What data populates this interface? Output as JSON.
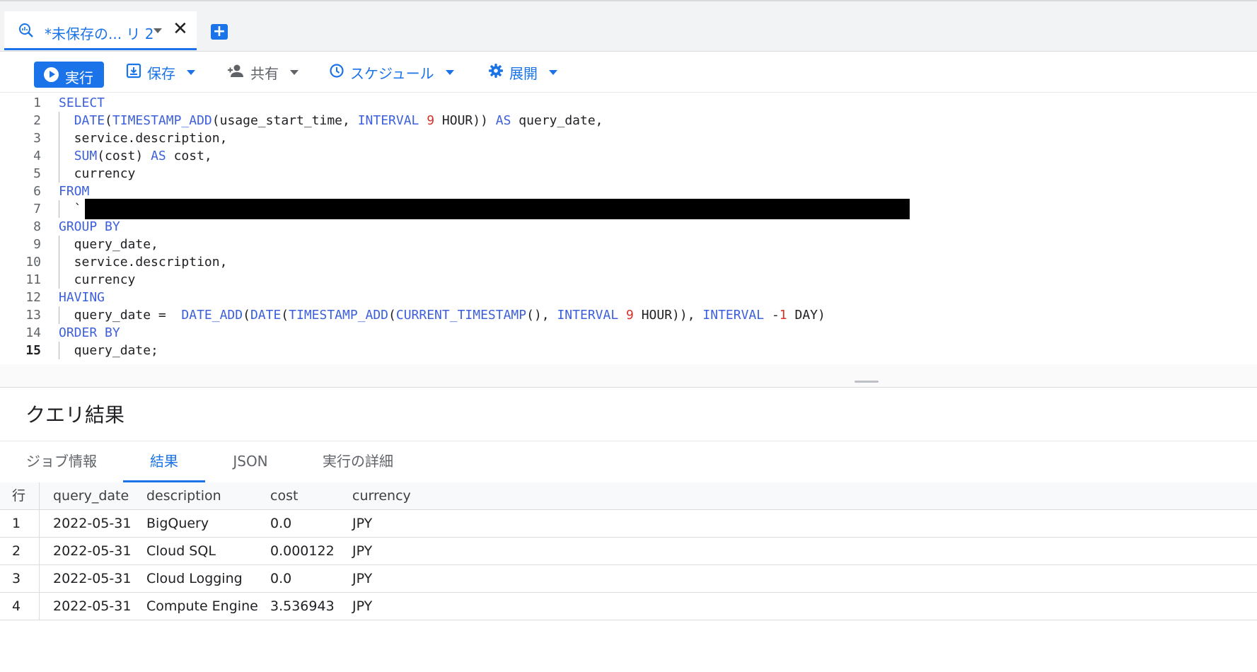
{
  "tab": {
    "title": "*未保存の... リ 2",
    "close": "✕",
    "new_tab": "+"
  },
  "toolbar": {
    "run": "実行",
    "save": "保存",
    "share": "共有",
    "schedule": "スケジュール",
    "expand": "展開"
  },
  "editor": {
    "active_line": 15,
    "lines": [
      {
        "n": "1",
        "indent": false
      },
      {
        "n": "2",
        "indent": true
      },
      {
        "n": "3",
        "indent": true
      },
      {
        "n": "4",
        "indent": true
      },
      {
        "n": "5",
        "indent": true
      },
      {
        "n": "6",
        "indent": false
      },
      {
        "n": "7",
        "indent": true
      },
      {
        "n": "8",
        "indent": false
      },
      {
        "n": "9",
        "indent": true
      },
      {
        "n": "10",
        "indent": true
      },
      {
        "n": "11",
        "indent": true
      },
      {
        "n": "12",
        "indent": false
      },
      {
        "n": "13",
        "indent": true
      },
      {
        "n": "14",
        "indent": false
      },
      {
        "n": "15",
        "indent": true
      }
    ],
    "code": [
      "<span class=\"kw\">SELECT</span>",
      "  <span class=\"fn\">DATE</span>(<span class=\"fn\">TIMESTAMP_ADD</span>(usage_start_time, <span class=\"kw\">INTERVAL</span> <span class=\"num\">9</span> HOUR)) <span class=\"kw\">AS</span> query_date,",
      "  service.description,",
      "  <span class=\"fn\">SUM</span>(cost) <span class=\"kw\">AS</span> cost,",
      "  currency",
      "<span class=\"kw\">FROM</span>",
      "  `",
      "<span class=\"kw\">GROUP BY</span>",
      "  query_date,",
      "  service.description,",
      "  currency",
      "<span class=\"kw\">HAVING</span>",
      "  query_date =  <span class=\"fn\">DATE_ADD</span>(<span class=\"fn\">DATE</span>(<span class=\"fn\">TIMESTAMP_ADD</span>(<span class=\"fn\">CURRENT_TIMESTAMP</span>(), <span class=\"kw\">INTERVAL</span> <span class=\"num\">9</span> HOUR)), <span class=\"kw\">INTERVAL</span> -<span class=\"num\">1</span> DAY)",
      "<span class=\"kw\">ORDER BY</span>",
      "  query_date;"
    ]
  },
  "results": {
    "title": "クエリ結果",
    "tabs": [
      "ジョブ情報",
      "結果",
      "JSON",
      "実行の詳細"
    ],
    "active_tab": 1,
    "columns": [
      "行",
      "query_date",
      "description",
      "cost",
      "currency"
    ],
    "rows": [
      [
        "1",
        "2022-05-31",
        "BigQuery",
        "0.0",
        "JPY"
      ],
      [
        "2",
        "2022-05-31",
        "Cloud SQL",
        "0.000122",
        "JPY"
      ],
      [
        "3",
        "2022-05-31",
        "Cloud Logging",
        "0.0",
        "JPY"
      ],
      [
        "4",
        "2022-05-31",
        "Compute Engine",
        "3.536943",
        "JPY"
      ]
    ]
  },
  "colors": {
    "accent": "#1a73e8",
    "keyword": "#3c5fdc",
    "number": "#d93025"
  },
  "icons": {
    "query_tab": "query-icon",
    "run": "play-circle-icon",
    "save": "save-icon",
    "share": "person-add-icon",
    "schedule": "clock-icon",
    "expand": "gear-icon"
  }
}
